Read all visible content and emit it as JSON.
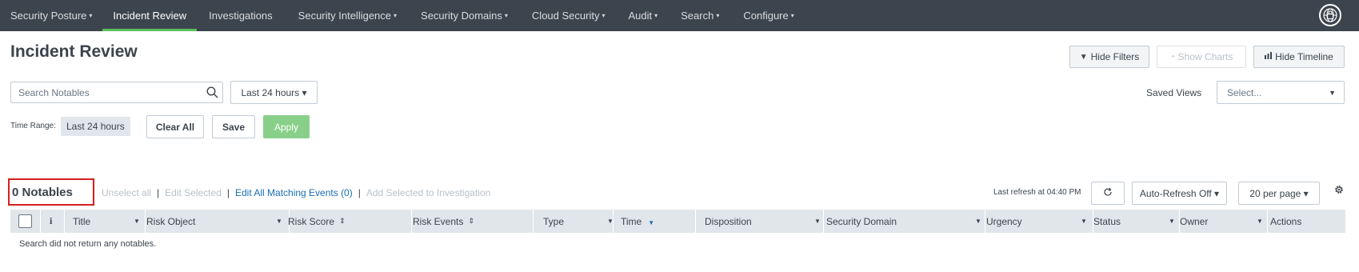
{
  "nav": {
    "items": [
      {
        "label": "Security Posture",
        "dropdown": true
      },
      {
        "label": "Incident Review",
        "dropdown": false,
        "active": true
      },
      {
        "label": "Investigations",
        "dropdown": false
      },
      {
        "label": "Security Intelligence",
        "dropdown": true
      },
      {
        "label": "Security Domains",
        "dropdown": true
      },
      {
        "label": "Cloud Security",
        "dropdown": true
      },
      {
        "label": "Audit",
        "dropdown": true
      },
      {
        "label": "Search",
        "dropdown": true
      },
      {
        "label": "Configure",
        "dropdown": true
      }
    ],
    "caret": "▾",
    "logo_icon": "lock-globe-icon"
  },
  "page": {
    "title": "Incident Review"
  },
  "toolbar": {
    "hide_filters": "Hide Filters",
    "show_charts": "Show Charts",
    "hide_timeline": "Hide Timeline"
  },
  "filters": {
    "search_placeholder": "Search Notables",
    "time_picker": "Last 24 hours ▾",
    "time_range_label": "Time Range:",
    "time_range_value": "Last 24 hours",
    "clear_all": "Clear All",
    "save": "Save",
    "apply": "Apply",
    "saved_views_label": "Saved Views",
    "saved_views_placeholder": "Select..."
  },
  "notables": {
    "count_text": "0 Notables",
    "unselect_all": "Unselect all",
    "edit_selected": "Edit Selected",
    "edit_all_matching": "Edit All Matching Events (0)",
    "add_selected": "Add Selected to Investigation",
    "separator": "|",
    "last_refresh": "Last refresh at 04:40 PM",
    "auto_refresh": "Auto-Refresh Off ▾",
    "per_page": "20 per page ▾"
  },
  "table": {
    "columns": {
      "info": "i",
      "title": "Title",
      "risk_object": "Risk Object",
      "risk_score": "Risk Score",
      "risk_events": "Risk Events",
      "type": "Type",
      "time": "Time",
      "disposition": "Disposition",
      "security_domain": "Security Domain",
      "urgency": "Urgency",
      "status": "Status",
      "owner": "Owner",
      "actions": "Actions"
    },
    "empty_message": "Search did not return any notables."
  },
  "colors": {
    "nav_bg": "#3c444d",
    "active_underline": "#5cc05c",
    "link": "#1a6fb5",
    "apply_green": "#88d08a",
    "highlight_red": "#d6201e",
    "header_bg": "#e1e6ea"
  }
}
